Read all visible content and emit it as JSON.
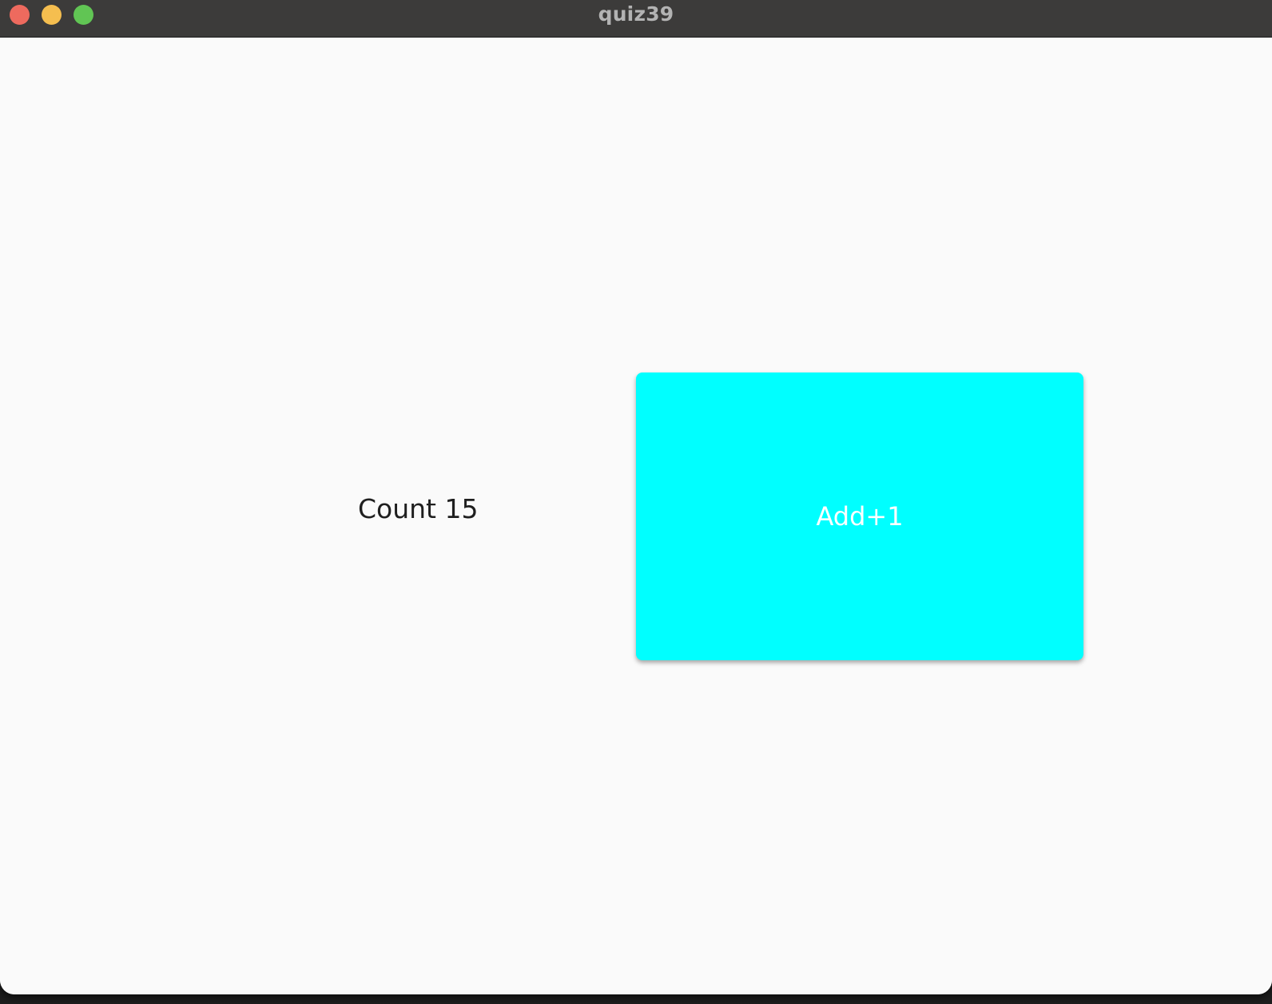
{
  "window": {
    "title": "quiz39"
  },
  "counter": {
    "label": "Count 15"
  },
  "add_button": {
    "label": "Add+1",
    "color": "#00ffff"
  },
  "colors": {
    "titlebar": "#3c3b3a",
    "background": "#fafafa",
    "close": "#ee6a5e",
    "minimize": "#f5be4f",
    "zoom": "#61c554"
  }
}
